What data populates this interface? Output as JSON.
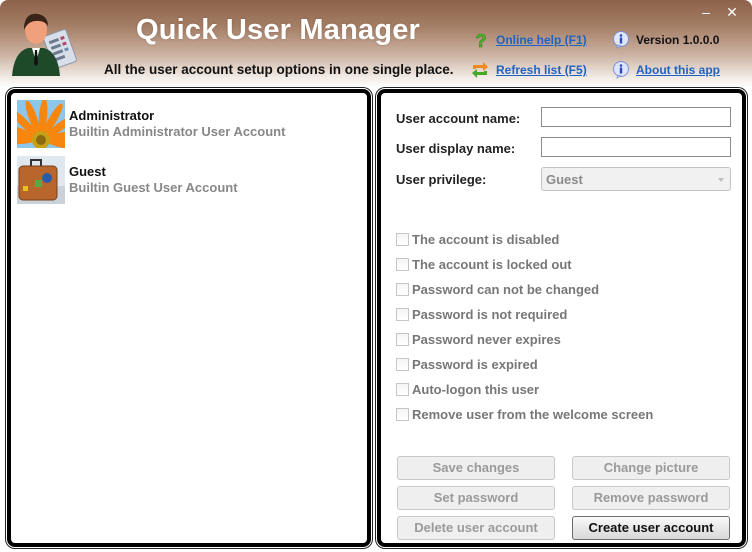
{
  "header": {
    "title": "Quick User Manager",
    "subtitle": "All the user account setup options in one single place.",
    "links": {
      "online_help": "Online help (F1)",
      "refresh_list": "Refresh list (F5)",
      "version": "Version 1.0.0.0",
      "about": "About this app"
    },
    "icons": {
      "logo": "user-manager-logo-icon",
      "help": "question-mark-icon",
      "refresh": "refresh-arrows-icon",
      "info": "info-bubble-icon"
    },
    "window_controls": {
      "minimize": "–",
      "close": "✕"
    }
  },
  "users": [
    {
      "name": "Administrator",
      "description": "Builtin Administrator User Account",
      "picture": "flower-picture"
    },
    {
      "name": "Guest",
      "description": "Builtin Guest User Account",
      "picture": "suitcase-picture"
    }
  ],
  "form": {
    "account_name_label": "User account name:",
    "account_name_value": "",
    "display_name_label": "User display name:",
    "display_name_value": "",
    "privilege_label": "User privilege:",
    "privilege_value": "Guest"
  },
  "options": [
    {
      "label": "The account is disabled",
      "checked": false
    },
    {
      "label": "The account is locked out",
      "checked": false
    },
    {
      "label": "Password can not be changed",
      "checked": false
    },
    {
      "label": "Password is not required",
      "checked": false
    },
    {
      "label": "Password never expires",
      "checked": false
    },
    {
      "label": "Password is expired",
      "checked": false
    },
    {
      "label": "Auto-logon this user",
      "checked": false
    },
    {
      "label": "Remove user from the welcome screen",
      "checked": false
    }
  ],
  "buttons": {
    "save_changes": "Save changes",
    "change_picture": "Change picture",
    "set_password": "Set password",
    "remove_password": "Remove password",
    "delete_account": "Delete user account",
    "create_account": "Create user account"
  },
  "colors": {
    "header_top": "#8d624a",
    "link": "#1e63c4",
    "disabled_text": "#9a9a9a"
  }
}
